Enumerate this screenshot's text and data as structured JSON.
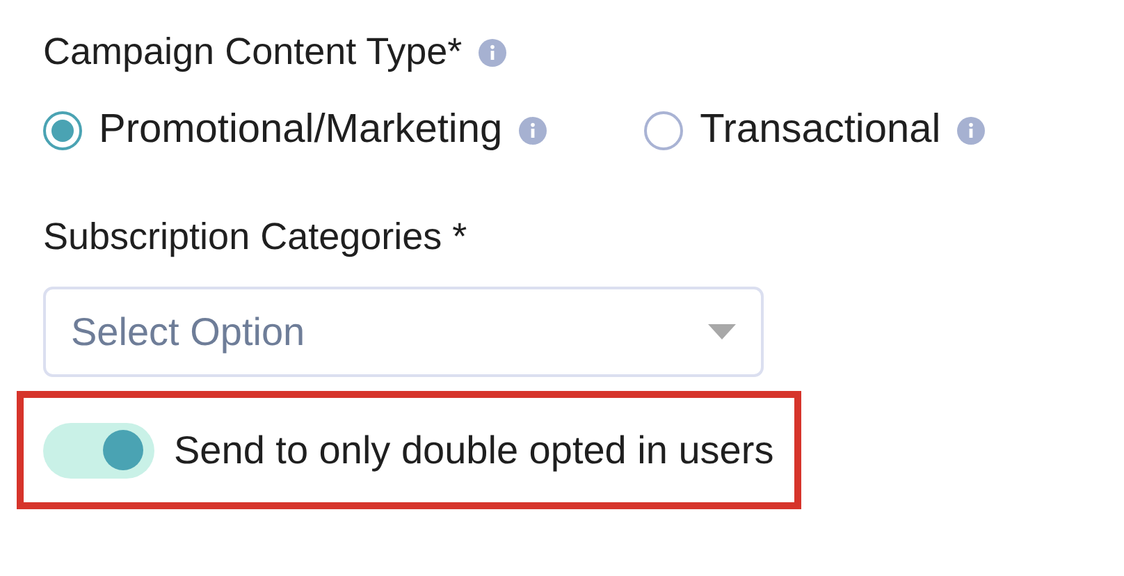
{
  "content_type": {
    "label": "Campaign Content Type*",
    "info": true,
    "options": [
      {
        "label": "Promotional/Marketing",
        "selected": true,
        "info": true
      },
      {
        "label": "Transactional",
        "selected": false,
        "info": true
      }
    ]
  },
  "subscription": {
    "label": "Subscription Categories *",
    "placeholder": "Select Option"
  },
  "double_opt_in": {
    "label": "Send to only double opted in users",
    "on": true,
    "highlighted": true
  }
}
